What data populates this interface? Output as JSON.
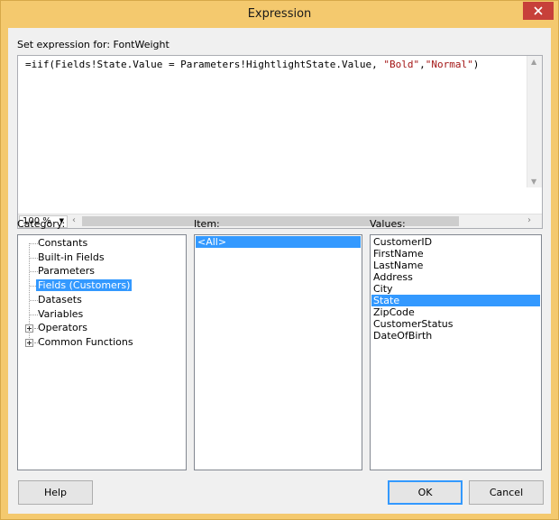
{
  "window": {
    "title": "Expression"
  },
  "expression": {
    "label": "Set expression for: FontWeight",
    "code_prefix": "=iif(Fields!State.Value = Parameters!HightlightState.Value, ",
    "str_bold": "\"Bold\"",
    "comma": ",",
    "str_normal": "\"Normal\"",
    "code_suffix": ")",
    "zoom": "100 %"
  },
  "category": {
    "label": "Category:",
    "items": [
      {
        "label": "Constants"
      },
      {
        "label": "Built-in Fields"
      },
      {
        "label": "Parameters"
      },
      {
        "label": "Fields (Customers)",
        "selected": true
      },
      {
        "label": "Datasets"
      },
      {
        "label": "Variables"
      },
      {
        "label": "Operators",
        "expandable": true
      },
      {
        "label": "Common Functions",
        "expandable": true
      }
    ]
  },
  "item": {
    "label": "Item:",
    "items": [
      {
        "label": "<All>",
        "selected": true
      }
    ]
  },
  "values": {
    "label": "Values:",
    "items": [
      {
        "label": "CustomerID"
      },
      {
        "label": "FirstName"
      },
      {
        "label": "LastName"
      },
      {
        "label": "Address"
      },
      {
        "label": "City"
      },
      {
        "label": "State",
        "selected": true
      },
      {
        "label": "ZipCode"
      },
      {
        "label": "CustomerStatus"
      },
      {
        "label": "DateOfBirth"
      }
    ]
  },
  "buttons": {
    "help": "Help",
    "ok": "OK",
    "cancel": "Cancel"
  },
  "colors": {
    "title_bar": "#f4c96e",
    "selection": "#3399ff",
    "close": "#c7403a",
    "string_literal": "#a31515"
  }
}
